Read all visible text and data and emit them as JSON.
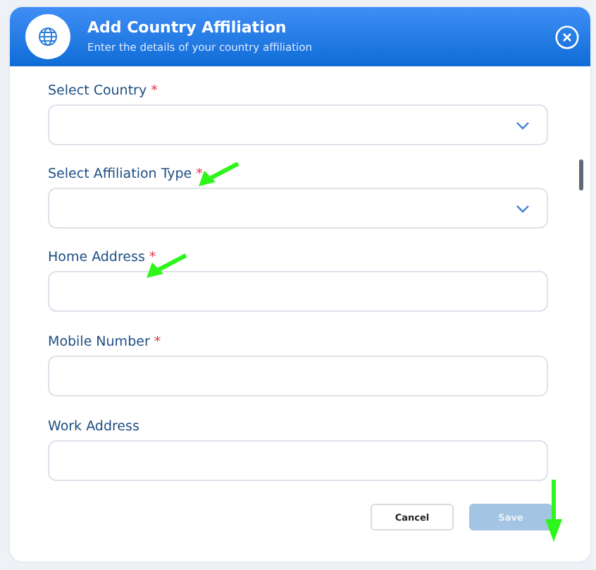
{
  "dialog": {
    "title": "Add Country Affiliation",
    "subtitle": "Enter the details of your country affiliation"
  },
  "fields": [
    {
      "kind": "select",
      "label": "Select Country",
      "required_mark": "*"
    },
    {
      "kind": "select",
      "label": "Select Affiliation Type",
      "required_mark": "*"
    },
    {
      "kind": "text",
      "label": "Home Address",
      "required_mark": "*"
    },
    {
      "kind": "text",
      "label": "Mobile Number",
      "required_mark": "*"
    },
    {
      "kind": "text",
      "label": "Work Address"
    }
  ],
  "buttons": [
    {
      "kind": "secondary",
      "label": "Cancel",
      "disabled": false
    },
    {
      "kind": "primary",
      "label": "Save",
      "disabled": true
    }
  ]
}
